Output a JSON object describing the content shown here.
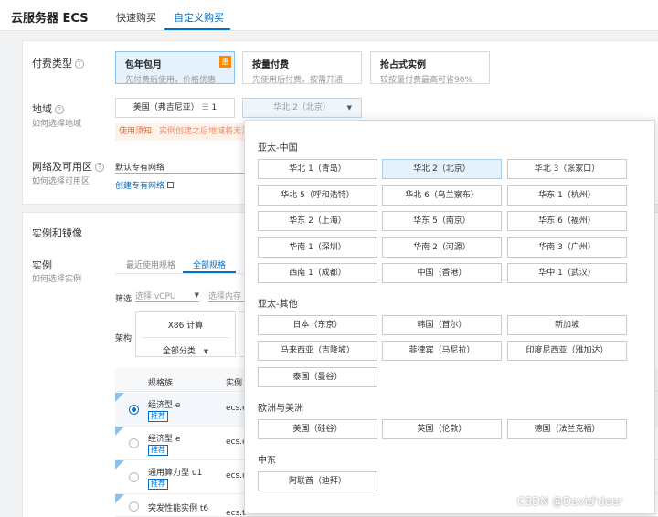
{
  "header": {
    "title": "云服务器 ECS",
    "tabs": [
      {
        "label": "快速购买"
      },
      {
        "label": "自定义购买"
      }
    ]
  },
  "billing": {
    "label": "付费类型",
    "options": [
      {
        "title": "包年包月",
        "desc": "先付费后使用，价格优惠",
        "badge": "惠"
      },
      {
        "title": "按量付费",
        "desc": "先使用后付费，按需开通"
      },
      {
        "title": "抢占式实例",
        "desc": "较按量付费最高可省90%"
      }
    ]
  },
  "region": {
    "label": "地域",
    "sublabel": "如何选择地域",
    "selected_region": "美国（弗吉尼亚）",
    "selected_count": "1",
    "zone_value": "华北 2（北京）",
    "notice_label": "使用须知",
    "notice_text": "实例创建之后地域将无法"
  },
  "network": {
    "label": "网络及可用区",
    "sublabel": "如何选择可用区",
    "value": "默认专有网络",
    "create_link": "创建专有网络"
  },
  "instance": {
    "section_title": "实例和镜像",
    "label": "实例",
    "sublabel": "如何选择实例",
    "subtabs": [
      {
        "label": "最近使用规格"
      },
      {
        "label": "全部规格"
      }
    ],
    "filter_label": "筛选",
    "vcpu_placeholder": "选择 vCPU",
    "mem_placeholder": "选择内存",
    "arch_label": "架构",
    "arch_header": "X86 计算",
    "arch_value": "全部分类",
    "table": {
      "headers": [
        "规格族",
        "实例"
      ],
      "rows": [
        {
          "name": "经济型 e",
          "tag": "推荐",
          "id": "ecs.e"
        },
        {
          "name": "经济型 e",
          "tag": "推荐",
          "id": "ecs.e"
        },
        {
          "name": "通用算力型 u1",
          "tag": "推荐",
          "id": "ecs.u"
        },
        {
          "name": "突发性能实例 t6",
          "tag": "",
          "id": "ecs.t"
        }
      ]
    }
  },
  "dropdown": {
    "groups": [
      {
        "title": "亚太-中国",
        "items": [
          "华北 1（青岛）",
          "华北 2（北京）",
          "华北 3（张家口）",
          "华北 5（呼和浩特）",
          "华北 6（乌兰察布）",
          "华东 1（杭州）",
          "华东 2（上海）",
          "华东 5（南京）",
          "华东 6（福州）",
          "华南 1（深圳）",
          "华南 2（河源）",
          "华南 3（广州）",
          "西南 1（成都）",
          "中国（香港）",
          "华中 1（武汉）"
        ]
      },
      {
        "title": "亚太-其他",
        "items": [
          "日本（东京）",
          "韩国（首尔）",
          "新加坡",
          "马来西亚（吉隆坡）",
          "菲律宾（马尼拉）",
          "印度尼西亚（雅加达）",
          "泰国（曼谷）"
        ]
      },
      {
        "title": "欧洲与美洲",
        "items": [
          "美国（硅谷）",
          "英国（伦敦）",
          "德国（法兰克福）"
        ]
      },
      {
        "title": "中东",
        "items": [
          "阿联酋（迪拜）"
        ]
      }
    ]
  },
  "watermark": "CSDN @David'deer",
  "colors": {
    "accent": "#0070cc",
    "selected_bg": "#e6f2fb",
    "notice": "#e8643b",
    "badge": "#ff8a00"
  }
}
